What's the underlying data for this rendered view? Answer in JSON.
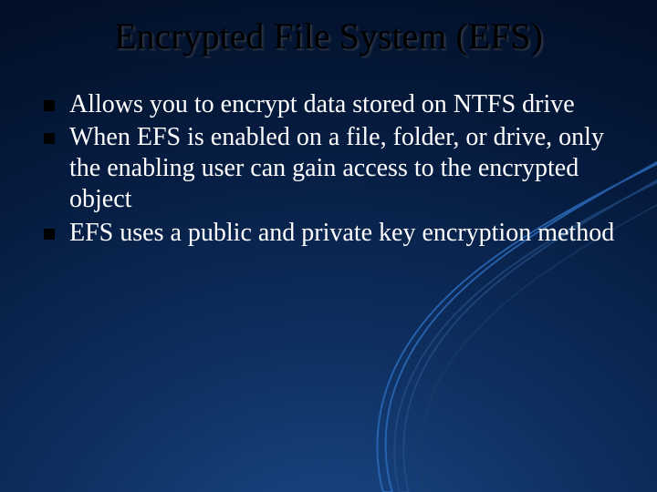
{
  "title": "Encrypted File System (EFS)",
  "bullets": [
    "Allows you to encrypt data stored on NTFS drive",
    "When EFS is enabled on a file, folder, or drive, only the enabling user can gain access to the encrypted object",
    "EFS uses a public and private key encryption method"
  ]
}
